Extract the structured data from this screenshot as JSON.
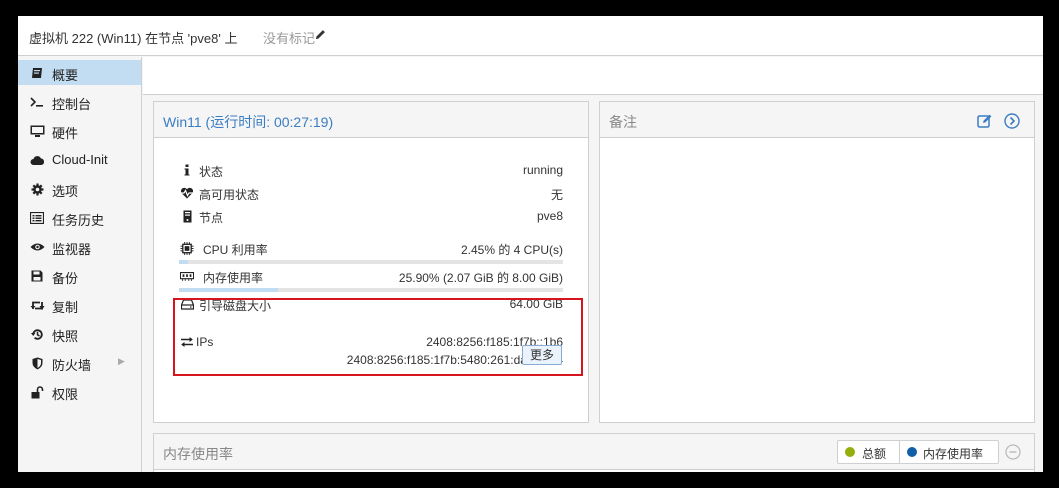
{
  "header": {
    "title": "虚拟机 222 (Win11) 在节点 'pve8' 上",
    "tags_placeholder": "没有标记",
    "edit_icon": "pencil-icon"
  },
  "sidebar": {
    "items": [
      {
        "label": "概要",
        "icon": "book-icon",
        "active": true
      },
      {
        "label": "控制台",
        "icon": "terminal-icon"
      },
      {
        "label": "硬件",
        "icon": "desktop-icon"
      },
      {
        "label": "Cloud-Init",
        "icon": "cloud-icon"
      },
      {
        "label": "选项",
        "icon": "gear-icon"
      },
      {
        "label": "任务历史",
        "icon": "list-icon"
      },
      {
        "label": "监视器",
        "icon": "eye-icon"
      },
      {
        "label": "备份",
        "icon": "floppy-icon"
      },
      {
        "label": "复制",
        "icon": "retweet-icon"
      },
      {
        "label": "快照",
        "icon": "history-icon"
      },
      {
        "label": "防火墙",
        "icon": "shield-icon",
        "has_submenu": true
      },
      {
        "label": "权限",
        "icon": "unlock-icon"
      }
    ]
  },
  "status_panel": {
    "title": "Win11 (运行时间: 00:27:19)",
    "rows": {
      "status": {
        "label": "状态",
        "value": "running",
        "icon": "info-icon"
      },
      "ha": {
        "label": "高可用状态",
        "value": "无",
        "icon": "heartbeat-icon"
      },
      "node": {
        "label": "节点",
        "value": "pve8",
        "icon": "server-icon"
      },
      "cpu": {
        "label": "CPU 利用率",
        "value": "2.45% 的 4 CPU(s)",
        "icon": "cpu-icon",
        "usage_fraction": 0.0245
      },
      "memory": {
        "label": "内存使用率",
        "value": "25.90% (2.07 GiB 的 8.00 GiB)",
        "icon": "memory-icon",
        "usage_fraction": 0.259
      },
      "bootdisk": {
        "label": "引导磁盘大小",
        "value": "64.00 GiB",
        "icon": "hdd-icon"
      }
    },
    "ips": {
      "label": "IPs",
      "icon": "exchange-icon",
      "addresses": [
        "2408:8256:f185:1f7b::1b6",
        "2408:8256:f185:1f7b:5480:261:da8c:d94"
      ],
      "more_label": "更多"
    }
  },
  "notes_panel": {
    "title": "备注",
    "edit_icon": "edit-icon",
    "toggle_icon": "chevron-right-circle-icon"
  },
  "memory_chart_panel": {
    "title": "内存使用率",
    "legend": [
      {
        "label": "总额",
        "color": "#94ae0a"
      },
      {
        "label": "内存使用率",
        "color": "#115fa6"
      }
    ],
    "collapse_icon": "minus-circle-icon"
  },
  "colors": {
    "accent": "#3b7dc3",
    "active_nav": "#c2ddf2",
    "highlight_border": "#d6141c"
  }
}
